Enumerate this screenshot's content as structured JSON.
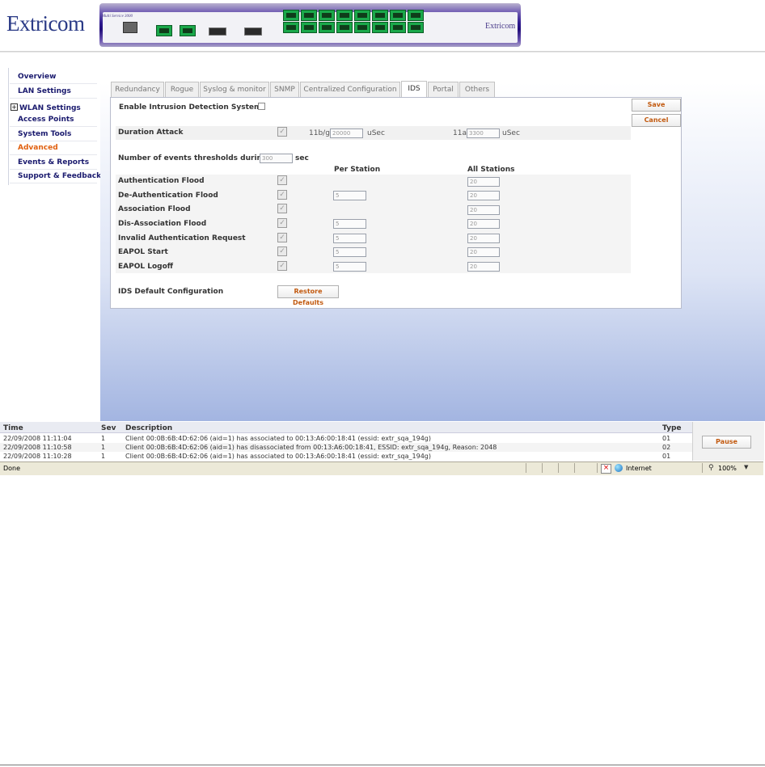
{
  "brand": {
    "logo_text": "Extricom",
    "device_model": "Multi Service 3000",
    "device_brand": "Extricom"
  },
  "sidebar": {
    "items": [
      {
        "label": "Overview"
      },
      {
        "label": "LAN Settings"
      },
      {
        "label": "WLAN Settings",
        "expander": "+"
      },
      {
        "label": "Access Points"
      },
      {
        "label": "System Tools"
      },
      {
        "label": "Advanced"
      },
      {
        "label": "Events & Reports"
      },
      {
        "label": "Support & Feedback"
      }
    ]
  },
  "tabs": [
    {
      "label": "Redundancy"
    },
    {
      "label": "Rogue"
    },
    {
      "label": "Syslog & monitor"
    },
    {
      "label": "SNMP"
    },
    {
      "label": "Centralized Configuration"
    },
    {
      "label": "IDS"
    },
    {
      "label": "Portal"
    },
    {
      "label": "Others"
    }
  ],
  "ids": {
    "enable_label": "Enable Intrusion Detection System",
    "save_label": "Save",
    "cancel_label": "Cancel",
    "duration": {
      "label": "Duration Attack",
      "bg_label": "11b/g",
      "bg_value": "20000",
      "bg_unit": "uSec",
      "a_label": "11a",
      "a_value": "3300",
      "a_unit": "uSec"
    },
    "events_label": "Number of events thresholds during",
    "events_value": "300",
    "events_unit": "sec",
    "col_per_station": "Per Station",
    "col_all_stations": "All Stations",
    "rows": [
      {
        "label": "Authentication Flood",
        "per": "",
        "all": "20"
      },
      {
        "label": "De-Authentication Flood",
        "per": "5",
        "all": "20"
      },
      {
        "label": "Association Flood",
        "per": "",
        "all": "20"
      },
      {
        "label": "Dis-Association Flood",
        "per": "5",
        "all": "20"
      },
      {
        "label": "Invalid Authentication Request",
        "per": "5",
        "all": "20"
      },
      {
        "label": "EAPOL Start",
        "per": "5",
        "all": "20"
      },
      {
        "label": "EAPOL Logoff",
        "per": "5",
        "all": "20"
      }
    ],
    "default_label": "IDS Default Configuration",
    "restore_label": "Restore Defaults"
  },
  "log": {
    "headers": {
      "time": "Time",
      "sev": "Sev",
      "desc": "Description",
      "type": "Type"
    },
    "rows": [
      {
        "time": "22/09/2008 11:11:04",
        "sev": "1",
        "desc": "Client 00:0B:6B:4D:62:06 (aid=1) has associated to 00:13:A6:00:18:41 (essid: extr_sqa_194g)",
        "type": "01"
      },
      {
        "time": "22/09/2008 11:10:58",
        "sev": "1",
        "desc": "Client 00:0B:6B:4D:62:06 (aid=1) has disassociated from 00:13:A6:00:18:41, ESSID: extr_sqa_194g, Reason: 2048",
        "type": "02"
      },
      {
        "time": "22/09/2008 11:10:28",
        "sev": "1",
        "desc": "Client 00:0B:6B:4D:62:06 (aid=1) has associated to 00:13:A6:00:18:41 (essid: extr_sqa_194g)",
        "type": "01"
      }
    ],
    "pause_label": "Pause"
  },
  "status": {
    "left": "Done",
    "zone": "Internet",
    "zoom": "100%"
  }
}
